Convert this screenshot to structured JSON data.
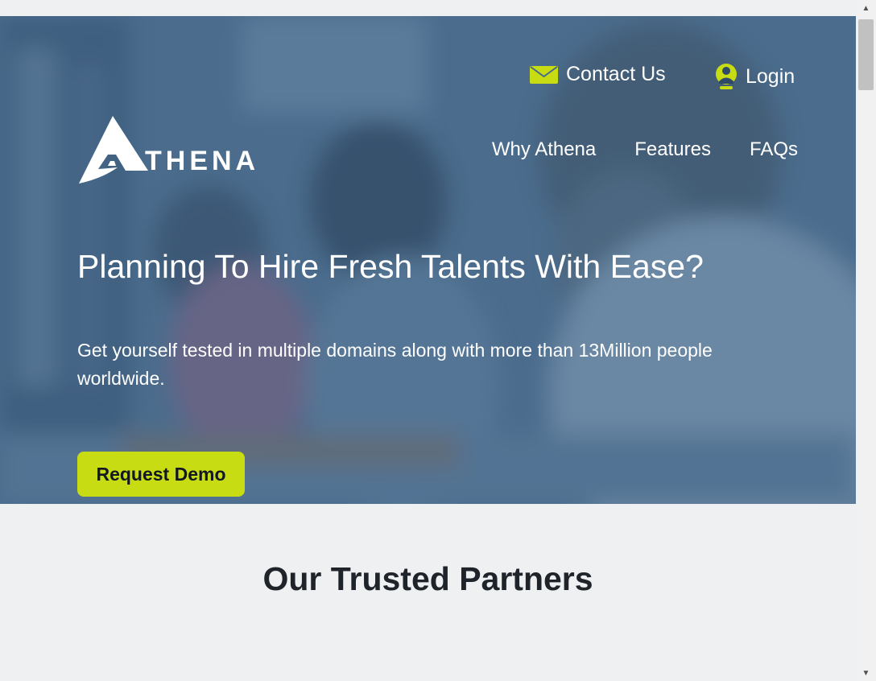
{
  "header": {
    "contact_label": "Contact Us",
    "login_label": "Login",
    "logo_text": "THENA",
    "logo_icon": "athena-a-mark"
  },
  "nav": {
    "items": [
      "Why Athena",
      "Features",
      "FAQs"
    ]
  },
  "hero": {
    "title": "Planning To Hire Fresh Talents With Ease?",
    "subtitle": "Get yourself tested in multiple domains along with more than 13Million people worldwide.",
    "cta_label": "Request Demo"
  },
  "partners": {
    "title": "Our Trusted Partners"
  },
  "icons": {
    "contact": "mail-icon",
    "login": "user-icon",
    "scroll_up": "scroll-up-arrow-icon",
    "scroll_down": "scroll-down-arrow-icon"
  },
  "colors": {
    "accent": "#c8dc14",
    "hero_overlay": "#3e6084",
    "page_background": "#eff0f2",
    "heading_text": "#1f242b"
  },
  "scrollbar": {
    "up_glyph": "▲",
    "down_glyph": "▼"
  }
}
